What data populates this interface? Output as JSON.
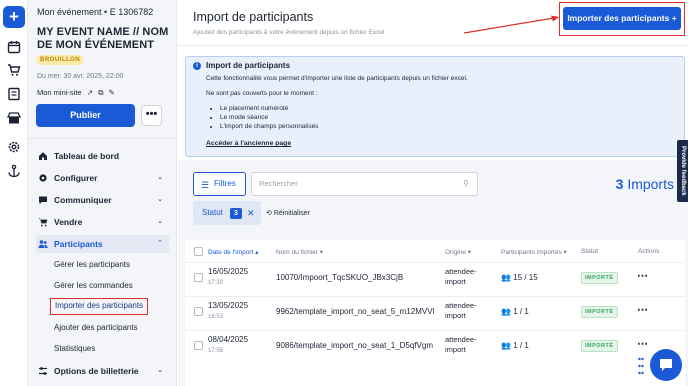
{
  "sidebar": {
    "event_top": "Mon événement • E 1306782",
    "event_name": "MY EVENT NAME // NOM DE MON ÉVÉNEMENT",
    "draft_badge": "BROUILLON",
    "event_date": "Du mer. 30 avr. 2025, 22:00",
    "mini_site": "Mon mini-site",
    "publish_label": "Publier",
    "more_label": "•••",
    "nav": [
      {
        "label": "Tableau de bord",
        "icon": "home-icon",
        "chevron": ""
      },
      {
        "label": "Configurer",
        "icon": "gear-icon",
        "chevron": "⌄"
      },
      {
        "label": "Communiquer",
        "icon": "chat-icon",
        "chevron": "⌄"
      },
      {
        "label": "Vendre",
        "icon": "cart-icon",
        "chevron": "⌄"
      },
      {
        "label": "Participants",
        "icon": "users-icon",
        "chevron": "⌃"
      },
      {
        "label": "Options de billetterie",
        "icon": "sliders-icon",
        "chevron": "⌄"
      }
    ],
    "participants_sub": [
      "Gérer les participants",
      "Gérer les commandes",
      "Importer des participants",
      "Ajouter des participants",
      "Statistiques"
    ]
  },
  "header": {
    "title": "Import de participants",
    "subtitle": "Ajoutez des participants à votre événement depuis un fichier Excel",
    "import_button": "Importer des participants +"
  },
  "info": {
    "title": "Import de participants",
    "line1": "Cette fonctionnalité vous permet d'importer une liste de participants depuis un fichier excel.",
    "line2": "Ne sont pas couverts pour le moment :",
    "bullets": [
      "Le placement numéroté",
      "Le mode séance",
      "L'import de champs personnalisés"
    ],
    "link": "Accéder à l'ancienne page"
  },
  "toolbar": {
    "filters_label": "Filtres",
    "search_placeholder": "Rechercher",
    "imports_count": "3",
    "imports_label": "Imports",
    "chip_label": "Statut",
    "chip_count": "3",
    "chip_close": "✕",
    "reset_label": "Réinitialiser"
  },
  "table": {
    "headers": {
      "date": "Date de l'import ▴",
      "file": "Nom du fichier ▾",
      "origin": "Origine ▾",
      "count": "Participants importés ▾",
      "status": "Statut",
      "actions": "Actions"
    },
    "rows": [
      {
        "date": "16/05/2025",
        "time": "17:30",
        "file": "10070/Impoort_TqcSKUO_JBx3CjB",
        "origin": "attendee-import",
        "count": "15 / 15",
        "status": "IMPORTÉ"
      },
      {
        "date": "13/05/2025",
        "time": "16:53",
        "file": "9962/template_import_no_seat_5_m12MVVl",
        "origin": "attendee-import",
        "count": "1 / 1",
        "status": "IMPORTÉ"
      },
      {
        "date": "08/04/2025",
        "time": "17:58",
        "file": "9086/template_import_no_seat_1_D5qfVgm",
        "origin": "attendee-import",
        "count": "1 / 1",
        "status": "IMPORTÉ"
      }
    ]
  },
  "feedback_label": "Provide feedback",
  "colors": {
    "accent": "#1a5ad7",
    "highlight": "#d9302e",
    "success": "#3ba35f",
    "draft": "#fbe9a8"
  }
}
